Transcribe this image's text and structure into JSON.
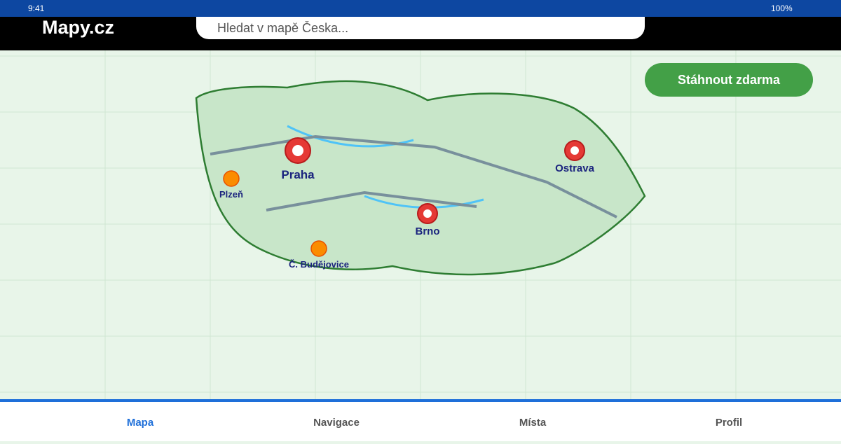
{
  "status_bar": {
    "time": "9:41",
    "battery": "100%"
  },
  "header": {
    "brand": "Mapy.cz"
  },
  "search": {
    "placeholder": "Hledat v mapě Česka..."
  },
  "map": {
    "download_button": "Stáhnout zdarma",
    "cities": {
      "praha": "Praha",
      "plzen": "Plzeň",
      "ostrava": "Ostrava",
      "brno": "Brno",
      "budejovice": "Č. Budějovice"
    }
  },
  "bottom_nav": {
    "items": [
      {
        "label": "Mapa"
      },
      {
        "label": "Navigace"
      },
      {
        "label": "Místa"
      },
      {
        "label": "Profil"
      }
    ]
  },
  "colors": {
    "status_bar": "#0d47a1",
    "map_background": "#e8f5e9",
    "country_fill": "#c8e6c9",
    "country_border": "#2e7d32",
    "road": "#78909c",
    "river": "#4fc3f7",
    "major_city_marker": "#e53935",
    "minor_city_marker": "#fb8c00",
    "city_label": "#1a237e",
    "download_button": "#43a047",
    "nav_active": "#1e6fd9"
  }
}
